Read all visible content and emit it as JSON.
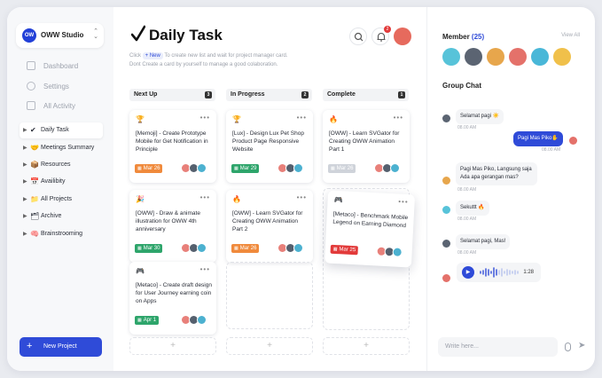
{
  "workspace": {
    "logo": "OW",
    "name": "OWW Studio"
  },
  "nav": [
    {
      "label": "Dashboard",
      "icon": "dashboard-icon"
    },
    {
      "label": "Settings",
      "icon": "gear-icon"
    },
    {
      "label": "All Activity",
      "icon": "activity-icon"
    }
  ],
  "tree": [
    {
      "label": "Daily Task",
      "emoji": "✔",
      "active": true
    },
    {
      "label": "Meetings Summary",
      "emoji": "🤝"
    },
    {
      "label": "Resources",
      "emoji": "📦"
    },
    {
      "label": "Availibity",
      "emoji": "📅"
    },
    {
      "label": "All Projects",
      "emoji": "📁"
    },
    {
      "label": "Archive",
      "emoji": "🗂"
    },
    {
      "label": "Brainstrooming",
      "emoji": "🧠"
    }
  ],
  "new_project": {
    "label": "New Project",
    "plus": "+"
  },
  "main": {
    "title": "Daily Task",
    "sub1_pre": "Click",
    "sub1_pill": "+ New",
    "sub1_post": "To create new list and wait for project manager card.",
    "sub2": "Dont Create a card by yourself to manage a good colaboration.",
    "notif_count": "2"
  },
  "columns": [
    {
      "name": "Next Up",
      "count": "3",
      "cards": [
        {
          "emoji": "🏆",
          "text": "[Memoji] - Create Prototype Mobile for Get Notification in Principle",
          "date": "Mar 26",
          "color": "#f08a3c"
        },
        {
          "emoji": "🎉",
          "text": "[OWW] - Draw & animate illustration for OWW 4th anniversary",
          "date": "Mar 30",
          "color": "#2ea56b"
        },
        {
          "emoji": "🎮",
          "text": "[Metaco] - Create draft design for User Journey earning coin on Apps",
          "date": "Apr 1",
          "color": "#2ea56b"
        }
      ]
    },
    {
      "name": "In Progress",
      "count": "2",
      "cards": [
        {
          "emoji": "🏆",
          "text": "[Lux] - Design Lux Pet Shop Product Page Responsive Website",
          "date": "Mar 29",
          "color": "#2ea56b"
        },
        {
          "emoji": "🔥",
          "text": "[OWW] - Learn SVGator for Creating OWW Animation Part 2",
          "date": "Mar 26",
          "color": "#f08a3c"
        }
      ]
    },
    {
      "name": "Complete",
      "count": "1",
      "cards": [
        {
          "emoji": "🔥",
          "text": "[OWW] - Learn SVGator for Creating OWW Animation Part 1",
          "date": "Mar 26",
          "color": "#cfd3da"
        },
        {
          "emoji": "🎮",
          "text": "[Metaco] - Benchmark Mobile Legend on Earning Diamond",
          "date": "Mar 25",
          "color": "#e23a3a"
        }
      ]
    }
  ],
  "add_label": "+",
  "member": {
    "title": "Member",
    "count": "(25)",
    "view_all": "View All"
  },
  "chat": {
    "title": "Group Chat",
    "messages": [
      {
        "text": "Selamat pagi ☀️",
        "time": "08.00 AM",
        "me": false
      },
      {
        "text": "Pagi Mas Piko✋",
        "time": "08.00 AM",
        "me": true
      },
      {
        "text": "Pagi Mas Piko, Langsung saja Ada apa gerangan mas?",
        "time": "08.00 AM",
        "me": false
      },
      {
        "text": "Sekuttt 🔥",
        "time": "08.00 AM",
        "me": false
      },
      {
        "text": "Selamat pagi, Mas!",
        "time": "08.00 AM",
        "me": false
      }
    ],
    "voice_duration": "1:28",
    "input_placeholder": "Write here..."
  },
  "colors": {
    "accent": "#2f4bd8",
    "orange": "#f08a3c",
    "green": "#2ea56b",
    "red": "#e23a3a"
  }
}
